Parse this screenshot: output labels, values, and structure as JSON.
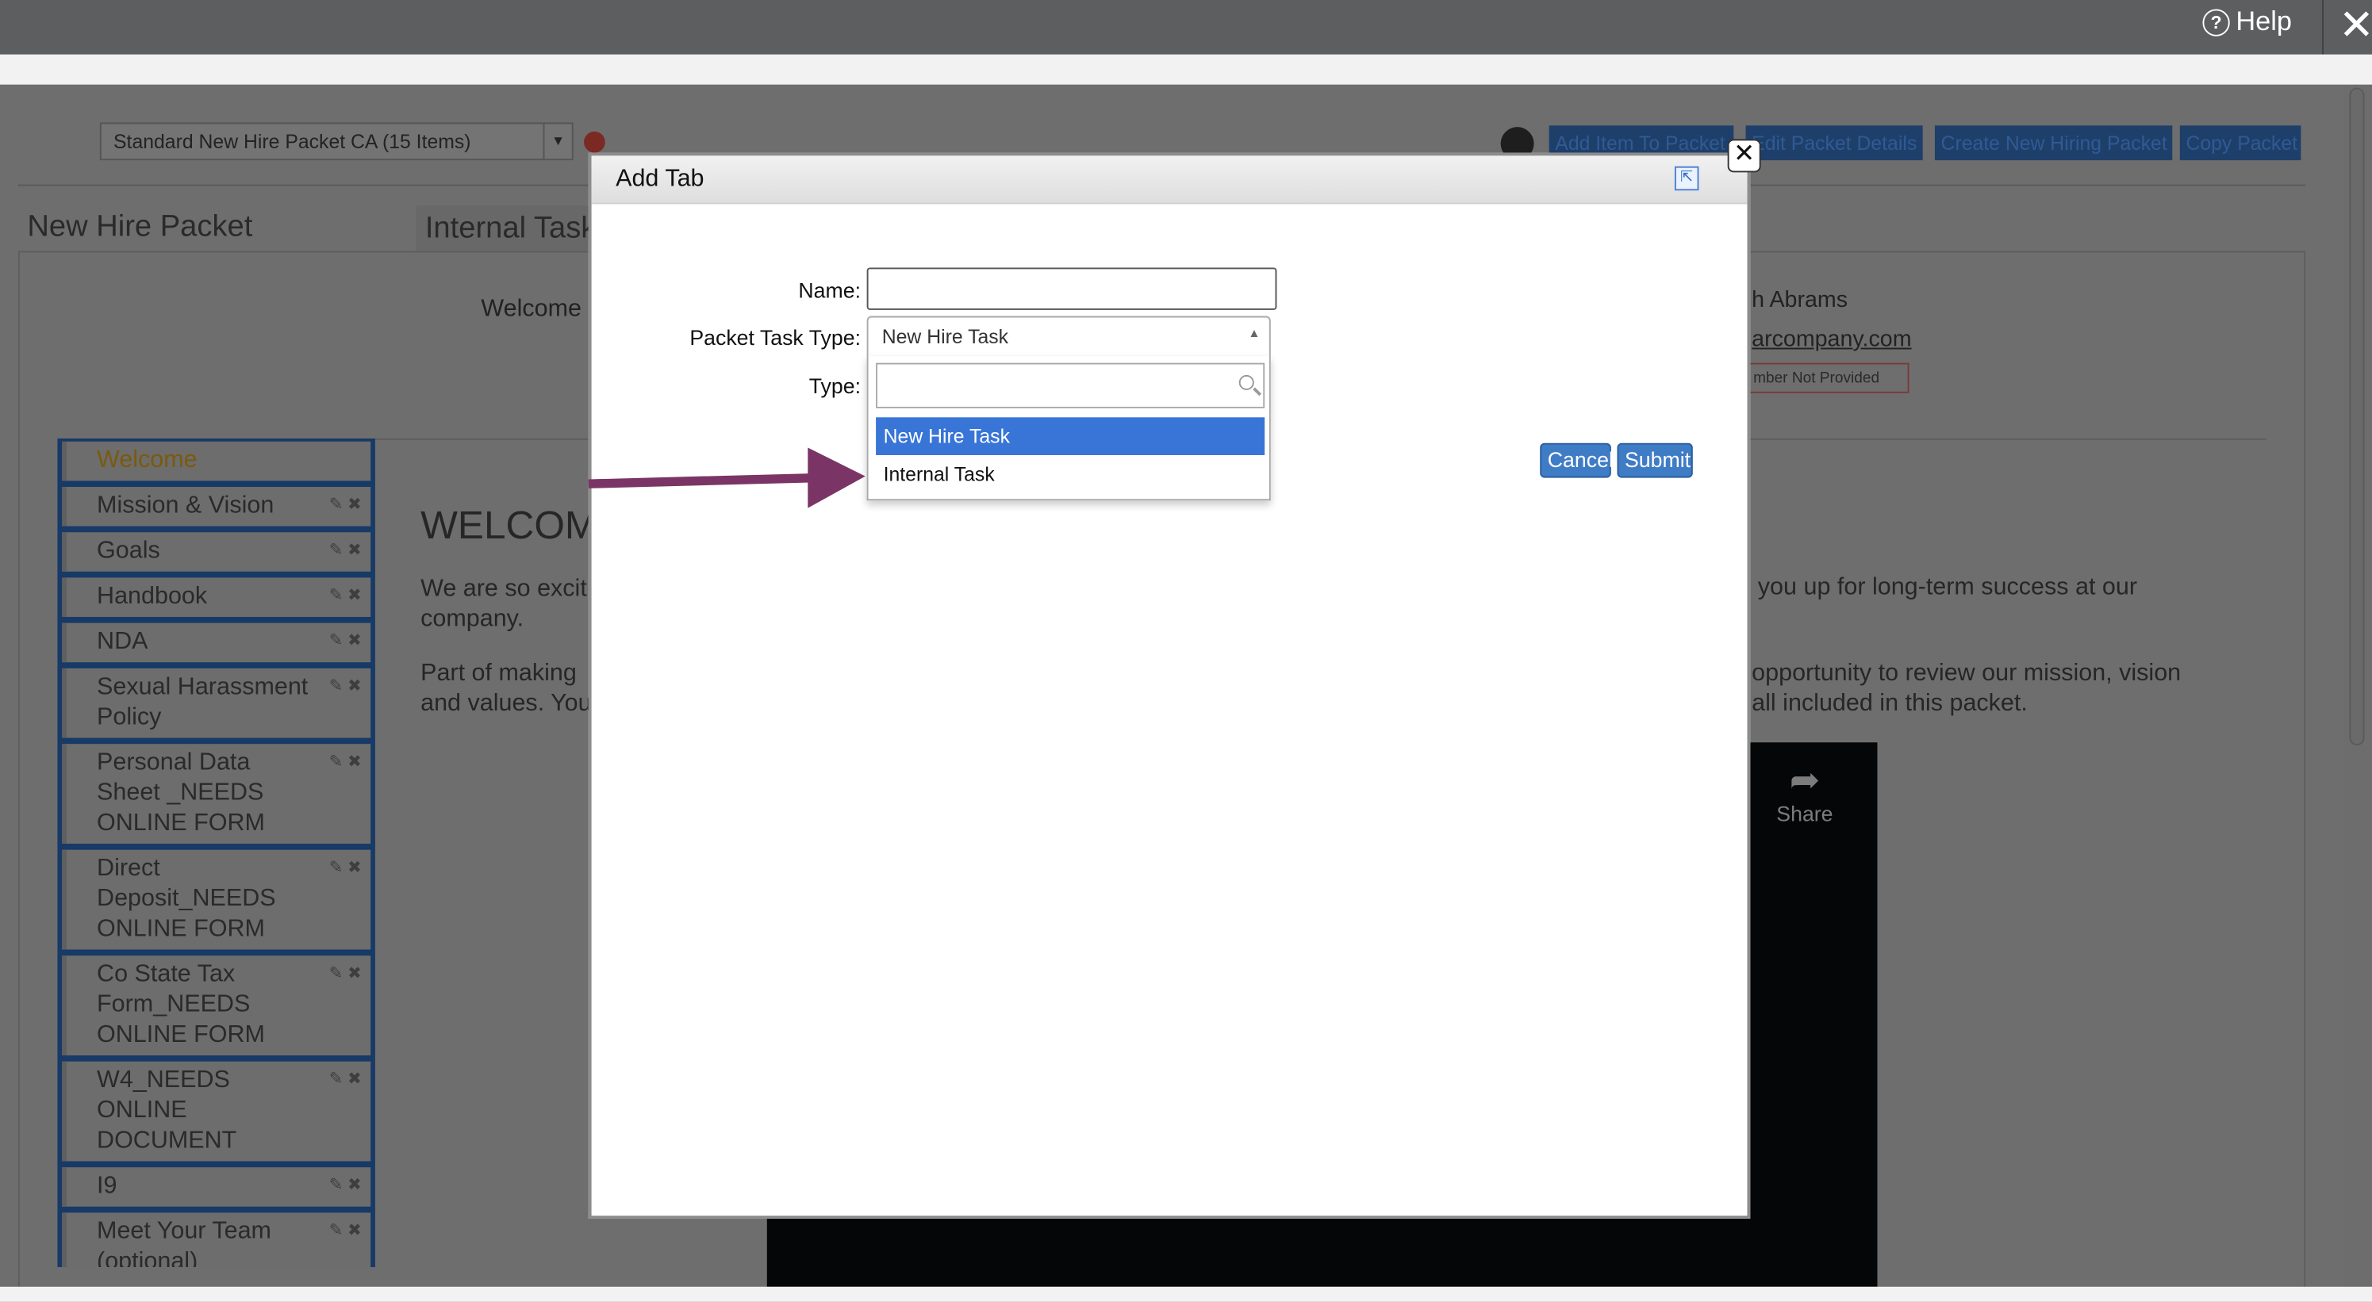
{
  "topbar": {
    "help_label": "Help",
    "help_icon": "?",
    "close_icon": "✕"
  },
  "background": {
    "packet_select_value": "Standard New Hire Packet CA (15 Items)",
    "buttons": [
      "Add Item To Packet",
      "Edit Packet Details",
      "Create New Hiring Packet",
      "Copy Packet"
    ],
    "page_title": "New Hire Packet",
    "active_tab": "Internal Tasks",
    "welcome_label": "Welcome",
    "employee_name": "h Abrams",
    "employee_email": "arcompany.com",
    "phone_badge": "mber Not Provided",
    "sidebar_items": [
      {
        "label": "Welcome"
      },
      {
        "label": "Mission & Vision"
      },
      {
        "label": "Goals"
      },
      {
        "label": "Handbook"
      },
      {
        "label": "NDA"
      },
      {
        "label": "Sexual Harassment Policy"
      },
      {
        "label": "Personal Data Sheet _NEEDS ONLINE FORM"
      },
      {
        "label": "Direct Deposit_NEEDS ONLINE FORM"
      },
      {
        "label": "Co State Tax Form_NEEDS ONLINE FORM"
      },
      {
        "label": "W4_NEEDS ONLINE DOCUMENT"
      },
      {
        "label": "I9"
      },
      {
        "label": "Meet Your Team (optional)"
      }
    ],
    "content_heading": "WELCOM",
    "para1_left": "We are so excit",
    "para1_left_line2": "company.",
    "para1_right": "you up for long-term success at our",
    "para2_left": "Part of making",
    "para2_left_line2": "and values. You",
    "para2_right": "opportunity to review our mission, vision",
    "para2_right_line2": "all included in this packet.",
    "video_share_label": "Share"
  },
  "modal": {
    "title": "Add Tab",
    "name_label": "Name:",
    "name_value": "",
    "packet_task_type_label": "Packet Task Type:",
    "packet_task_type_value": "New Hire Task",
    "type_label": "Type:",
    "dropdown_search_value": "",
    "dropdown_options": [
      {
        "label": "New Hire Task",
        "selected": true
      },
      {
        "label": "Internal Task",
        "selected": false
      }
    ],
    "cancel_label": "Cancel",
    "submit_label": "Submit"
  },
  "colors": {
    "accent": "#3875d7",
    "button": "#3f7cc6",
    "annotation_arrow": "#7a3566",
    "overlay": "#6d6d6d"
  }
}
